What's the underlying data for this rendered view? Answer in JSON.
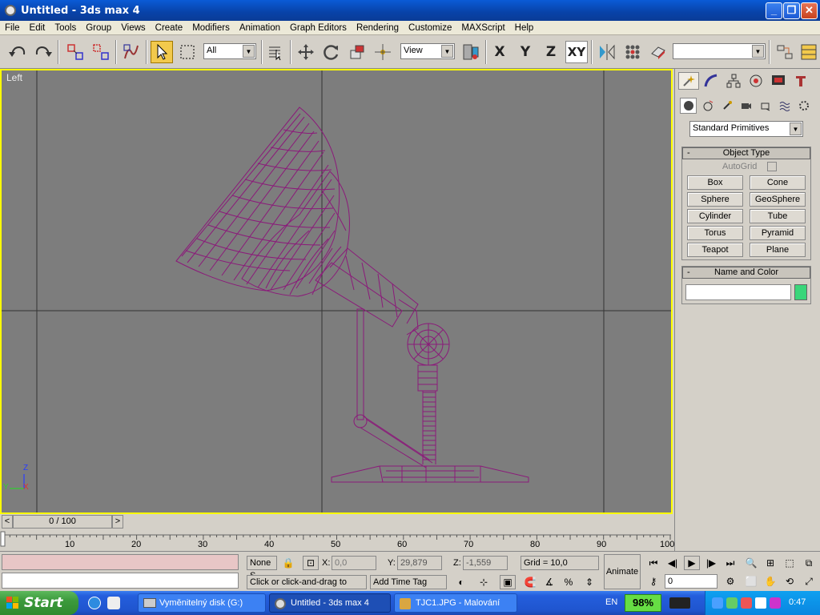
{
  "window": {
    "title": "Untitled - 3ds max 4"
  },
  "menu": [
    "File",
    "Edit",
    "Tools",
    "Group",
    "Views",
    "Create",
    "Modifiers",
    "Animation",
    "Graph Editors",
    "Rendering",
    "Customize",
    "MAXScript",
    "Help"
  ],
  "toolbar": {
    "selection_filter": "All",
    "ref_coord": "View",
    "axis_x": "X",
    "axis_y": "Y",
    "axis_z": "Z",
    "axis_xy": "XY",
    "named_selection": ""
  },
  "viewport": {
    "label": "Left",
    "axis_y": "Y",
    "axis_z": "Z",
    "axis_x": "X"
  },
  "command_panel": {
    "category": "Standard Primitives",
    "object_type": {
      "title": "Object Type",
      "autogrid": "AutoGrid",
      "buttons": [
        "Box",
        "Cone",
        "Sphere",
        "GeoSphere",
        "Cylinder",
        "Tube",
        "Torus",
        "Pyramid",
        "Teapot",
        "Plane"
      ]
    },
    "name_color": {
      "title": "Name and Color",
      "name_value": "",
      "swatch_color": "#3ad67a"
    }
  },
  "timeline": {
    "frame_display": "0 / 100",
    "ticks": [
      "10",
      "20",
      "30",
      "40",
      "50",
      "60",
      "70",
      "80",
      "90",
      "100"
    ]
  },
  "status": {
    "selection": "None S",
    "x_label": "X:",
    "x_value": "0,0",
    "y_label": "Y:",
    "y_value": "29,879",
    "z_label": "Z:",
    "z_value": "-1,559",
    "grid": "Grid = 10,0",
    "prompt": "Click or click-and-drag to selec",
    "add_time_tag": "Add Time Tag",
    "animate": "Animate",
    "current_frame": "0"
  },
  "taskbar": {
    "start": "Start",
    "tasks": [
      "Vyměnitelný disk (G:)",
      "Untitled - 3ds max 4",
      "TJC1.JPG - Malování"
    ],
    "lang": "EN",
    "battery": "98%",
    "clock": "0:47"
  },
  "colors": {
    "wireframe": "#8b1a7a",
    "viewport_bg": "#7d7d7d",
    "active_border": "#ffff00"
  }
}
